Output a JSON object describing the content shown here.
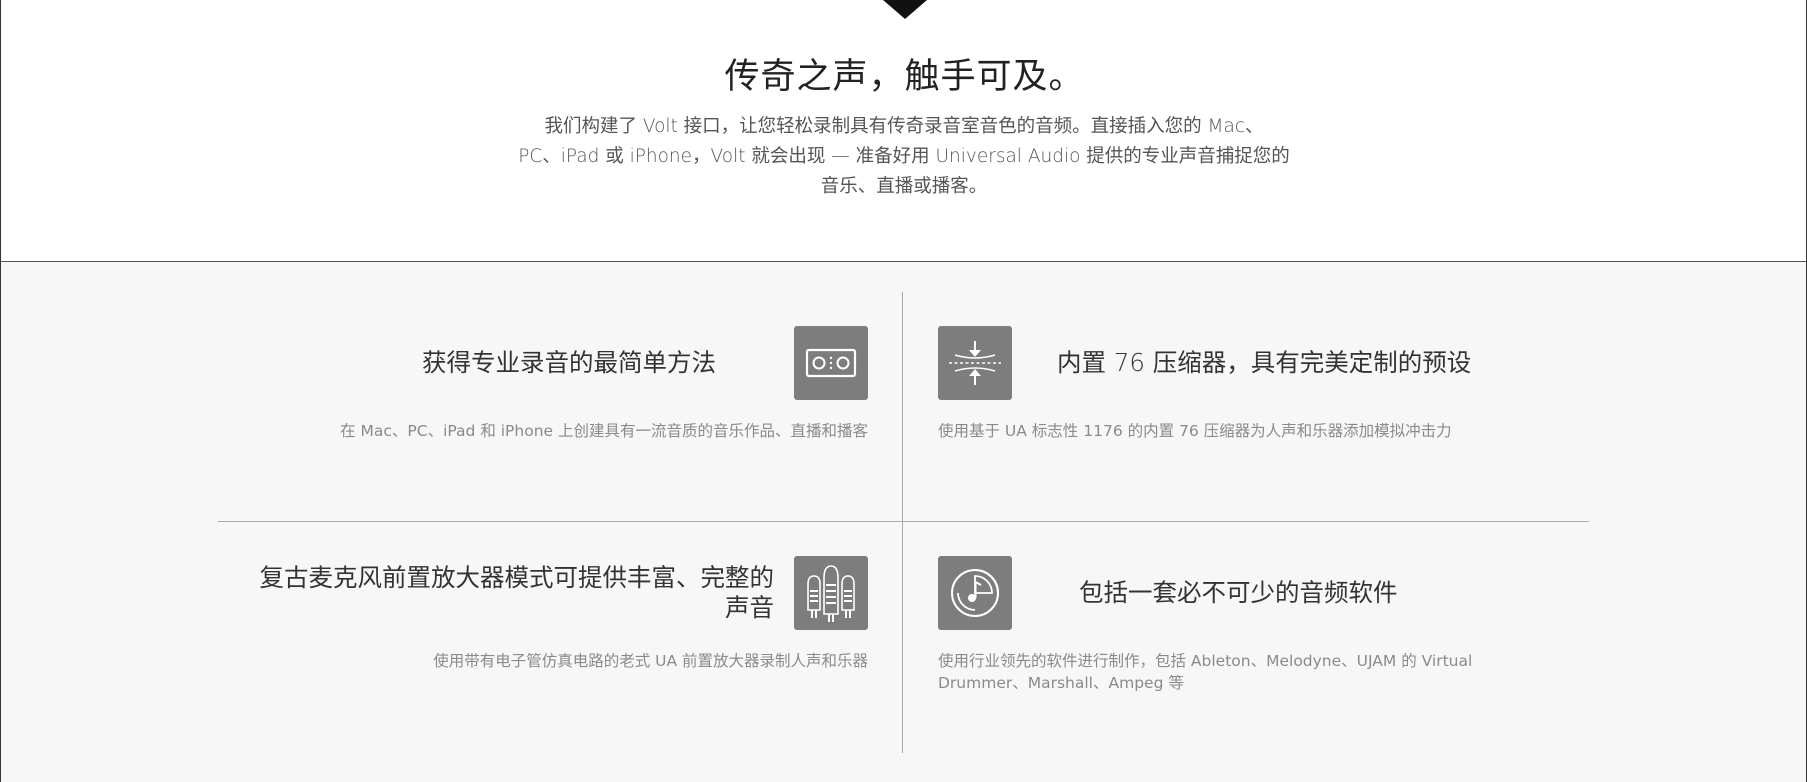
{
  "hero": {
    "title": "传奇之声，触手可及。",
    "text_lines": [
      "我们构建了 Volt 接口，让您轻松录制具有传奇录音室音色的音频。直接插入您的 Mac、",
      "PC、iPad 或 iPhone，Volt 就会出现 — 准备好用 Universal Audio 提供的专业声音捕捉您的",
      "音乐、直播或播客。"
    ]
  },
  "features": [
    {
      "title": "获得专业录音的最简单方法",
      "desc": "在 Mac、PC、iPad 和 iPhone 上创建具有一流音质的音乐作品、直播和播客",
      "icon": "audio-interface-icon"
    },
    {
      "title": "内置 76 压缩器，具有完美定制的预设",
      "desc": "使用基于 UA 标志性 1176 的内置 76 压缩器为人声和乐器添加模拟冲击力",
      "icon": "compressor-icon"
    },
    {
      "title_lines": [
        "复古麦克风前置放大器模式可提供丰富、完整的",
        "声音"
      ],
      "desc": "使用带有电子管仿真电路的老式 UA 前置放大器录制人声和乐器",
      "icon": "vacuum-tube-icon"
    },
    {
      "title": "包括一套必不可少的音频软件",
      "desc_lines": [
        "使用行业领先的软件进行制作，包括 Ableton、Melodyne、UJAM 的 Virtual",
        "Drummer、Marshall、Ampeg 等"
      ],
      "icon": "music-software-icon"
    }
  ],
  "colors": {
    "icon_tile": "#7d7d7d",
    "section_bg": "#f7f7f7",
    "divider": "#aaaaaa"
  }
}
